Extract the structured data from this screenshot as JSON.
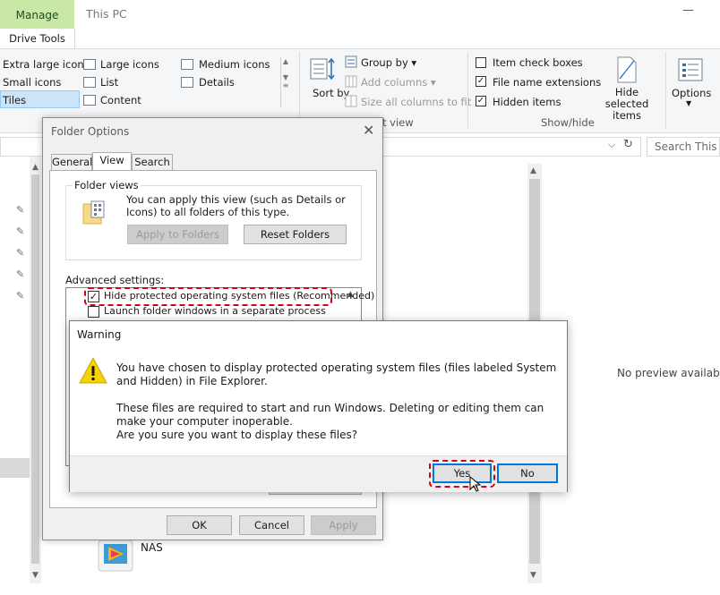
{
  "window": {
    "title": "This PC",
    "tabs": {
      "manage": "Manage",
      "drive_tools": "Drive Tools"
    }
  },
  "ribbon": {
    "layout": {
      "items": [
        "Extra large icons",
        "Large icons",
        "Medium icons",
        "Small icons",
        "List",
        "Details",
        "Tiles",
        "Content"
      ],
      "selected": "Tiles"
    },
    "current_view": {
      "sort_by": "Sort by",
      "group_by": "Group by",
      "add_columns": "Add columns",
      "size_all_columns": "Size all columns to fit",
      "label_partial": "t view"
    },
    "show_hide": {
      "item_check_boxes": {
        "label": "Item check boxes",
        "checked": false
      },
      "file_name_extensions": {
        "label": "File name extensions",
        "checked": true
      },
      "hidden_items": {
        "label": "Hidden items",
        "checked": true
      },
      "hide_selected_items": "Hide selected items",
      "group_label": "Show/hide"
    },
    "options": "Options"
  },
  "address": {
    "search_placeholder": "Search This PC"
  },
  "preview": {
    "text": "No preview available."
  },
  "nas_item": {
    "label": "NAS"
  },
  "folder_options": {
    "title": "Folder Options",
    "tabs": [
      "General",
      "View",
      "Search"
    ],
    "active_tab": "View",
    "folder_views": {
      "label": "Folder views",
      "description": "You can apply this view (such as Details or Icons) to all folders of this type.",
      "apply_button": "Apply to Folders",
      "reset_button": "Reset Folders"
    },
    "advanced_label": "Advanced settings:",
    "advanced_items": [
      {
        "label": "Hide protected operating system files (Recommended)",
        "checked": true
      },
      {
        "label": "Launch folder windows in a separate process",
        "checked": false
      }
    ],
    "buttons": {
      "ok": "OK",
      "cancel": "Cancel",
      "apply": "Apply"
    }
  },
  "warning": {
    "title": "Warning",
    "line1": "You have chosen to display protected operating system files (files labeled System and Hidden) in File Explorer.",
    "line2": "These files are required to start and run Windows. Deleting or editing them can make your computer inoperable.",
    "line3": "Are you sure you want to display these files?",
    "yes": "Yes",
    "no": "No"
  },
  "colors": {
    "accent": "#0078d7",
    "highlight_dash": "#d6001c",
    "manage_tab": "#c9e7a7",
    "warning_icon": "#f6d100"
  }
}
